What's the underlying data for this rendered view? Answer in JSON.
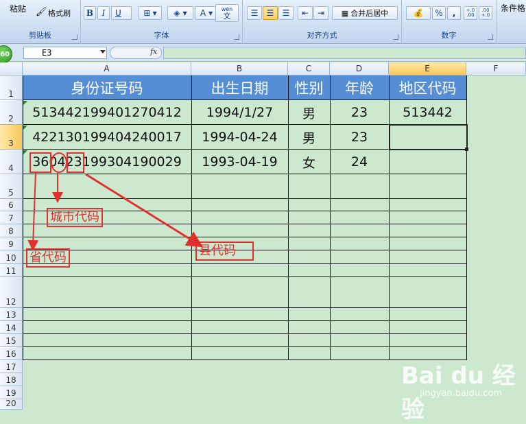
{
  "ribbon": {
    "paste_label": "粘贴",
    "format_painter_label": "格式刷",
    "clipboard_group": "剪贴板",
    "font_group": "字体",
    "align_group": "对齐方式",
    "number_group": "数字",
    "merge_label": "合并后居中",
    "percent": "%",
    "comma": ",",
    "inc_decimal": "+.0 .00",
    "dec_decimal": ".00 +.0",
    "bold": "B",
    "italic": "I",
    "underline": "U",
    "font_color_letter": "A",
    "phonetic_top": "wén",
    "phonetic_bottom": "文",
    "conditional_label": "条件格"
  },
  "formula_bar": {
    "name_box": "E3",
    "fx": "fx",
    "formula": ""
  },
  "badge": "60",
  "columns": [
    "A",
    "B",
    "C",
    "D",
    "E",
    "F"
  ],
  "rows": [
    "1",
    "2",
    "3",
    "4",
    "5",
    "6",
    "7",
    "8",
    "9",
    "10",
    "11",
    "12",
    "13",
    "14",
    "15",
    "16",
    "17",
    "18",
    "19",
    "20"
  ],
  "table": {
    "headers": [
      "身份证号码",
      "出生日期",
      "性别",
      "年龄",
      "地区代码"
    ],
    "rows": [
      [
        "513442199401270412",
        "1994/1/27",
        "男",
        "23",
        "513442"
      ],
      [
        "422130199404240017",
        "1994-04-24",
        "男",
        "23",
        ""
      ],
      [
        "360423199304190029",
        "1993-04-19",
        "女",
        "24",
        ""
      ]
    ]
  },
  "annotations": {
    "city": "城市代码",
    "province": "省代码",
    "county": "县代码"
  },
  "watermark": {
    "brand": "Bai du 经验",
    "url": "jingyan.baidu.com"
  }
}
